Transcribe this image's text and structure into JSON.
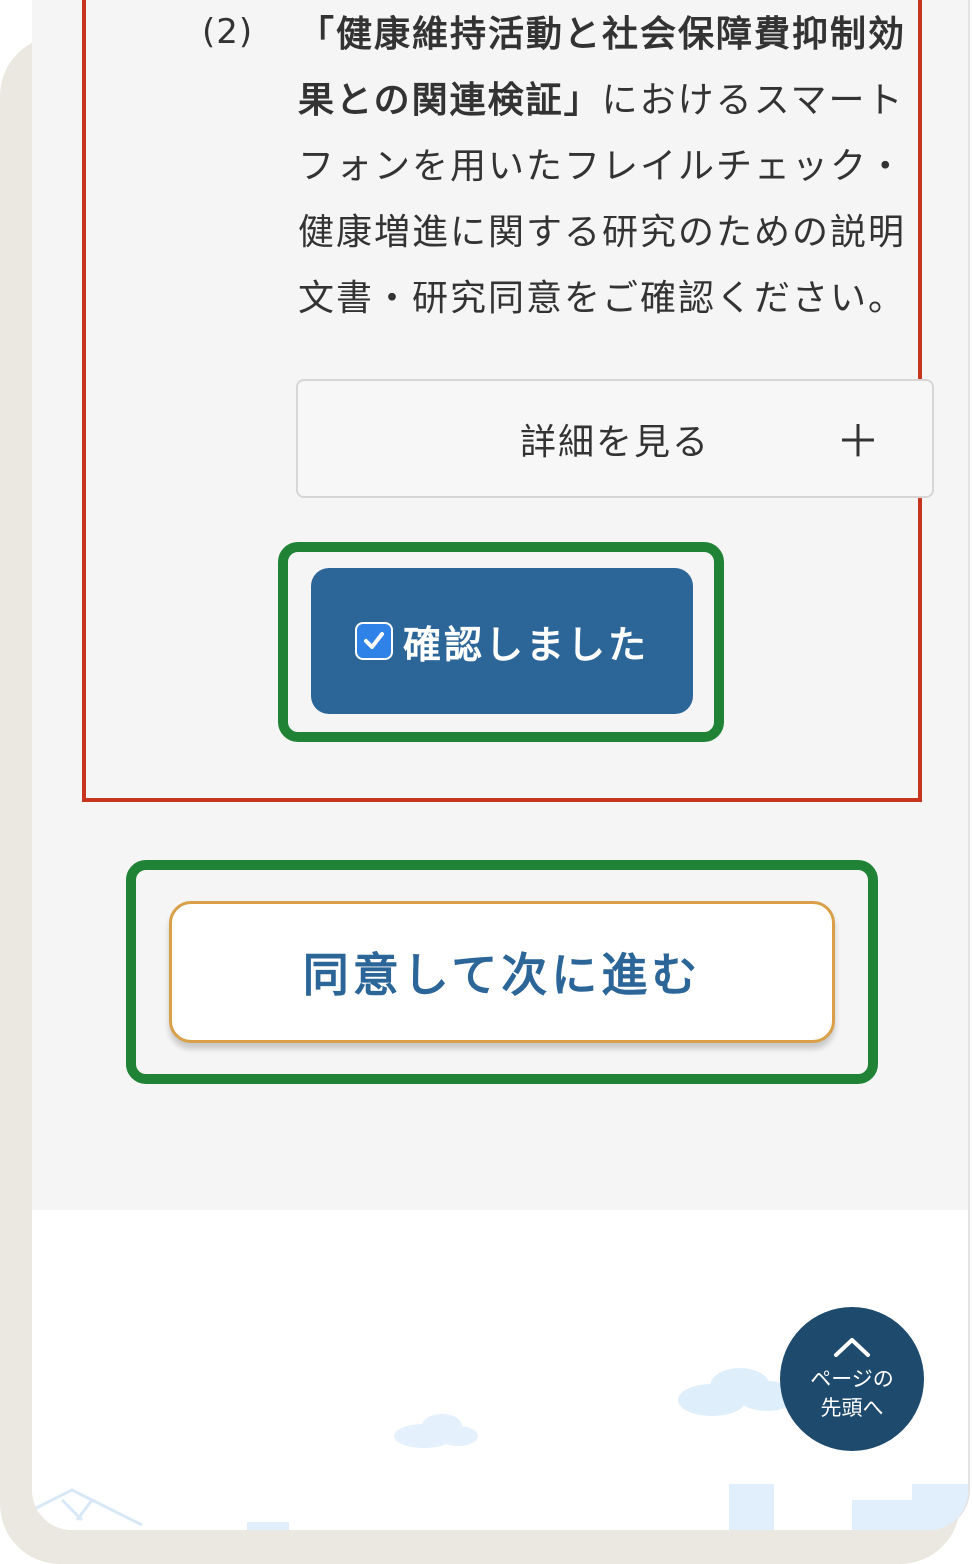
{
  "consent_item": {
    "number": "(2)",
    "title_bold": "「健康維持活動と社会保障費抑制効果との関連検証」",
    "text": "におけるスマートフォンを用いたフレイルチェック・健康増進に関する研究のための説明文書・研究同意をご確認ください。"
  },
  "details_button": {
    "label": "詳細を見る",
    "icon": "plus-icon"
  },
  "confirm_button": {
    "label": "確認しました",
    "checked": true,
    "icon": "checkbox-checked-icon"
  },
  "next_button": {
    "label": "同意して次に進む"
  },
  "page_top_button": {
    "line1": "ページの",
    "line2": "先頭へ",
    "icon": "chevron-up-icon"
  },
  "colors": {
    "primary": "#2c6699",
    "highlight_red": "#c8351f",
    "highlight_green": "#1f8235",
    "next_border": "#d9a04a",
    "page_top_bg": "#1e4a6e"
  }
}
